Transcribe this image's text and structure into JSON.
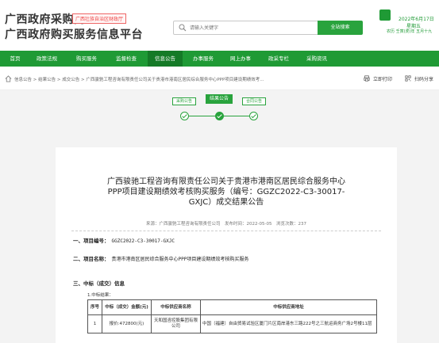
{
  "header": {
    "site_title_1": "广西政府采购网",
    "site_badge": "广西壮族自治区财政厅",
    "site_title_2": "广西政府购买服务信息平台",
    "search_placeholder": "请输入关键字",
    "search_button": "全站搜索",
    "date": {
      "line1": "2022年6月17日",
      "line2": "星期五",
      "line3": "农历 壬寅(虎)年 五月十九"
    }
  },
  "nav": {
    "items": [
      "首页",
      "政策法规",
      "购买服务",
      "监督检查",
      "信息公告",
      "办事服务",
      "网上办事",
      "政采专栏",
      "采购资讯"
    ],
    "active_index": 4
  },
  "breadcrumb": {
    "text": "信息公告 > 结果公告 > 成交公告 > 广西骏驰工程咨询有限责任公司关于贵港市港南区居民综合服务中心PPP项目建设期绩效考...",
    "print_label": "立即打印",
    "share_label": "扫码分享"
  },
  "steps": {
    "items": [
      "采购公告",
      "结果公告",
      "合同公告"
    ],
    "current_index": 1
  },
  "article": {
    "title_line1": "广西骏驰工程咨询有限责任公司关于贵港市港南区居民综合服务中心",
    "title_line2": "PPP项目建设期绩效考核购买服务（编号：GGZC2022-C3-30017-",
    "title_line3": "GXJC）成交结果公告",
    "meta": "来源：广西骏驰工程咨询有限责任公司　发布时间：2022-05-05　浏览次数：237",
    "sec1_label": "一、项目编号：",
    "sec1_value": "GGZC2022-C3-30017-GXJC",
    "sec2_label": "二、项目名称：",
    "sec2_value": "贵港市港南区居民综合服务中心PPP项目建设期绩效考核购买服务",
    "sec3_label": "三、中标（成交）信息",
    "sub1": "1.中标结果：",
    "table": {
      "headers": [
        "序号",
        "中标（成交）金额(元)",
        "中标供应商名称",
        "中标供应商地址"
      ],
      "rows": [
        {
          "no": "1",
          "amount": "报价:472800(元)",
          "name": "天和国咨控股集团有限公司",
          "address": "中国（福建）自由贸易试验区厦门片区南岸港东三路222号之三航运商务广场2号楼11层"
        }
      ]
    }
  },
  "colors": {
    "brand_green": "#29a33d",
    "nav_green": "#1f9a35",
    "badge_red": "#e44444"
  }
}
